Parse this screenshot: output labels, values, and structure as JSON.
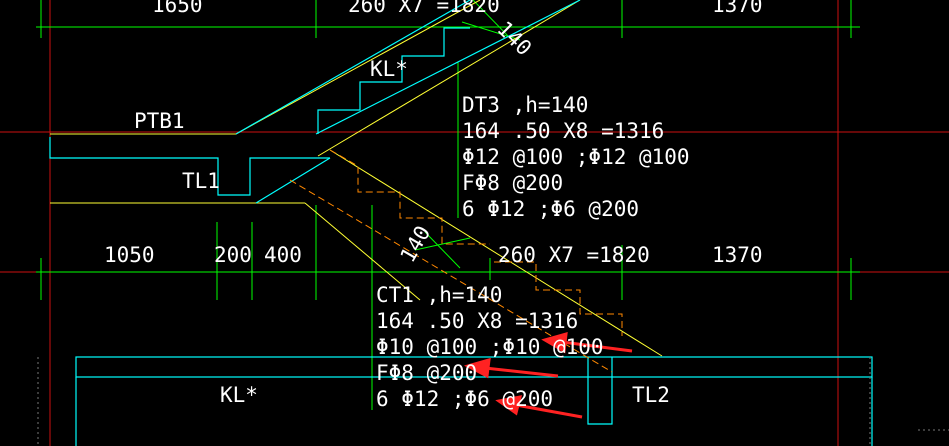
{
  "colors": {
    "background": "#000000",
    "dim": "#00ff00",
    "text": "#ffffff",
    "slab": "#00ffff",
    "yellow": "#ffff33",
    "axis": "#cc1111",
    "hidden": "#ff8800",
    "arrow": "#ff2222"
  },
  "top_dims": {
    "left": "1650",
    "middle": "260 X7 =1820",
    "right": "1370"
  },
  "bottom_dims": {
    "left": "1050",
    "mid1": "200",
    "mid2": "400",
    "middle": "260 X7 =1820",
    "right": "1370"
  },
  "labels": {
    "kl_top": "KL*",
    "ptb": "PTB1",
    "tl1": "TL1",
    "kl_bottom": "KL*",
    "tl2": "TL2",
    "thick_top": "140",
    "thick_bottom": "140"
  },
  "dt3": {
    "line1": "DT3 ,h=140",
    "line2": "164 .50 X8 =1316",
    "line3": "Φ12 @100 ;Φ12 @100",
    "line4": "FΦ8 @200",
    "line5": "6 Φ12 ;Φ6 @200"
  },
  "ct1": {
    "line1": "CT1 ,h=140",
    "line2": "164 .50 X8 =1316",
    "line3": "Φ10 @100 ;Φ10 @100",
    "line4": "FΦ8 @200",
    "line5": "6 Φ12 ;Φ6 @200"
  }
}
